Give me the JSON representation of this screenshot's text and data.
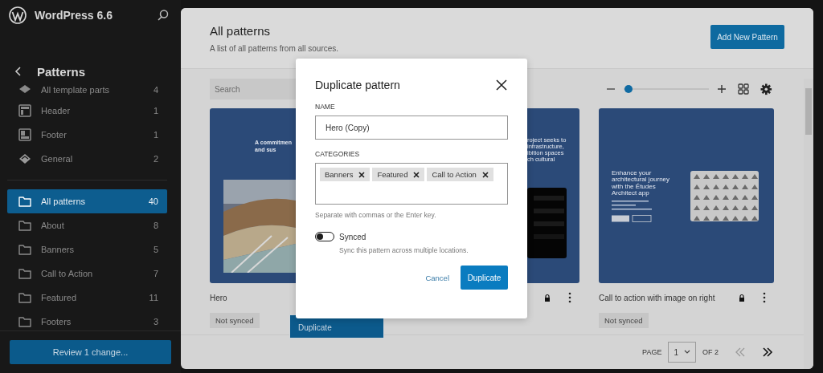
{
  "sidebar": {
    "title": "WordPress 6.6",
    "heading": "Patterns",
    "items": [
      {
        "kind": "template-parts",
        "label": "All template parts",
        "count": "4",
        "selected": false
      },
      {
        "kind": "header",
        "label": "Header",
        "count": "1",
        "selected": false
      },
      {
        "kind": "footer",
        "label": "Footer",
        "count": "1",
        "selected": false
      },
      {
        "kind": "general",
        "label": "General",
        "count": "2",
        "selected": false
      },
      {
        "kind": "divider"
      },
      {
        "kind": "folder",
        "label": "All patterns",
        "count": "40",
        "selected": true
      },
      {
        "kind": "folder",
        "label": "About",
        "count": "8",
        "selected": false
      },
      {
        "kind": "folder",
        "label": "Banners",
        "count": "5",
        "selected": false
      },
      {
        "kind": "folder",
        "label": "Call to Action",
        "count": "7",
        "selected": false
      },
      {
        "kind": "folder",
        "label": "Featured",
        "count": "11",
        "selected": false
      },
      {
        "kind": "folder",
        "label": "Footers",
        "count": "3",
        "selected": false
      }
    ],
    "review_button": "Review 1 change..."
  },
  "page": {
    "title": "All patterns",
    "subtitle": "A list of all patterns from all sources.",
    "add_button": "Add New Pattern",
    "search": {
      "placeholder": "Search"
    },
    "zoom": {
      "level": 0.03
    },
    "patterns": [
      {
        "kind": "hero",
        "title": "Hero",
        "badge": "Not synced",
        "preview_lines": [
          "A commitmen",
          "and sus"
        ]
      },
      {
        "kind": "project",
        "locked": true,
        "more_menu": true,
        "preview_lines": [
          "roject seeks to",
          "infrastructure,",
          "ibition spaces",
          "ch cultural"
        ]
      },
      {
        "kind": "cta",
        "title": "Call to action with image on right",
        "badge": "Not synced",
        "locked": true,
        "more_menu": true,
        "preview_lines": [
          "Enhance your architectural journey with the Études Architect app"
        ]
      }
    ],
    "pagination": {
      "label": "PAGE",
      "page": "1",
      "of": "OF 2"
    }
  },
  "menu": {
    "items": [
      "Duplicate"
    ]
  },
  "dialog": {
    "title": "Duplicate pattern",
    "name_label": "NAME",
    "name_value": "Hero (Copy)",
    "categories_label": "CATEGORIES",
    "categories": [
      "Banners",
      "Featured",
      "Call to Action"
    ],
    "help": "Separate with commas or the Enter key.",
    "synced": {
      "label": "Synced",
      "on": false,
      "help": "Sync this pattern across multiple locations."
    },
    "cancel": "Cancel",
    "confirm": "Duplicate"
  }
}
